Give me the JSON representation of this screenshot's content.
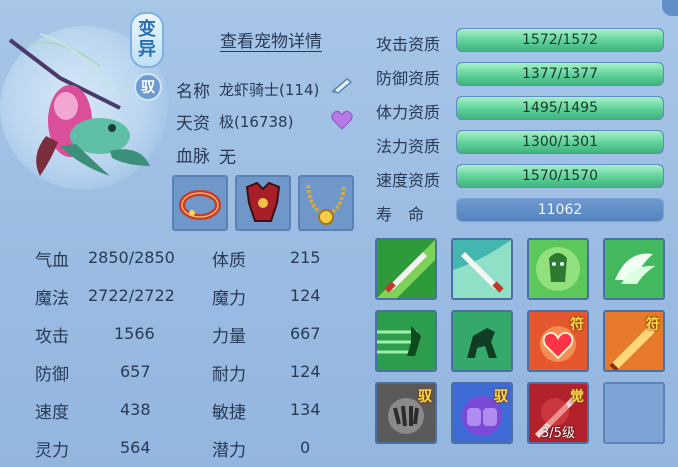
{
  "header": {
    "mutation_badge": "变异",
    "tame_badge": "驭",
    "view_details": "查看宠物详情"
  },
  "info": {
    "name_label": "名称",
    "name_value": "龙虾骑士(114)",
    "aptitude_label": "天资",
    "aptitude_value": "极(16738)",
    "bloodline_label": "血脉",
    "bloodline_value": "无"
  },
  "equipment": [
    {
      "name": "red-collar"
    },
    {
      "name": "red-armor"
    },
    {
      "name": "gold-necklace"
    }
  ],
  "stats": {
    "hp_label": "气血",
    "hp_value": "2850/2850",
    "mp_label": "魔法",
    "mp_value": "2722/2722",
    "atk_label": "攻击",
    "atk_value": "1566",
    "def_label": "防御",
    "def_value": "657",
    "spd_label": "速度",
    "spd_value": "438",
    "spi_label": "灵力",
    "spi_value": "564",
    "con_label": "体质",
    "con_value": "215",
    "mag_label": "魔力",
    "mag_value": "124",
    "str_label": "力量",
    "str_value": "667",
    "end_label": "耐力",
    "end_value": "124",
    "agi_label": "敏捷",
    "agi_value": "134",
    "pot_label": "潜力",
    "pot_value": "0"
  },
  "aptitudes": [
    {
      "label": "攻击资质",
      "value": "1572/1572",
      "fill": 1.0
    },
    {
      "label": "防御资质",
      "value": "1377/1377",
      "fill": 1.0
    },
    {
      "label": "体力资质",
      "value": "1495/1495",
      "fill": 1.0
    },
    {
      "label": "法力资质",
      "value": "1300/1301",
      "fill": 0.999
    },
    {
      "label": "速度资质",
      "value": "1570/1570",
      "fill": 1.0
    }
  ],
  "life": {
    "label": "寿　命",
    "value": "11062"
  },
  "skills": [
    {
      "name": "sword-skill"
    },
    {
      "name": "sword-skill-2"
    },
    {
      "name": "ghost-skill"
    },
    {
      "name": "wing-skill"
    },
    {
      "name": "dash-skill"
    },
    {
      "name": "horse-skill"
    },
    {
      "name": "heart-talisman-skill",
      "tag": "符"
    },
    {
      "name": "blade-talisman-skill",
      "tag": "符"
    },
    {
      "name": "claw-tame-skill",
      "tag": "驭"
    },
    {
      "name": "fist-tame-skill",
      "tag": "驭"
    },
    {
      "name": "awaken-skill",
      "tag": "觉",
      "level": "3/5级"
    },
    {
      "name": "empty-skill-slot"
    }
  ],
  "colors": {
    "accent": "#5fd09a",
    "panel": "#9dbde3",
    "text": "#283a56"
  }
}
